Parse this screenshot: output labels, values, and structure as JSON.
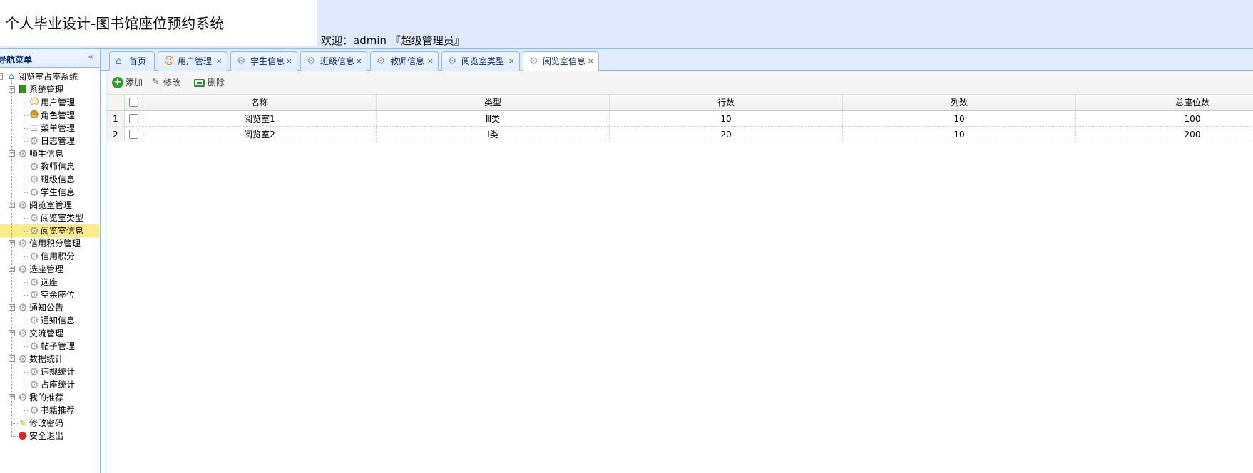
{
  "header": {
    "app_title": "个人毕业设计-图书馆座位预约系统",
    "welcome_prefix": "欢迎：",
    "username": "admin",
    "role": "『超级管理员』"
  },
  "sidebar": {
    "title": "导航菜单",
    "collapse_icon": "double-chevron-left-icon",
    "tree": {
      "root": "阅览室占座系统",
      "groups": [
        {
          "label": "系统管理",
          "items": [
            "用户管理",
            "角色管理",
            "菜单管理",
            "日志管理"
          ]
        },
        {
          "label": "师生信息",
          "items": [
            "教师信息",
            "班级信息",
            "学生信息"
          ]
        },
        {
          "label": "阅览室管理",
          "items": [
            "阅览室类型",
            "阅览室信息"
          ]
        },
        {
          "label": "信用积分管理",
          "items": [
            "信用积分"
          ]
        },
        {
          "label": "选座管理",
          "items": [
            "选座",
            "空余座位"
          ]
        },
        {
          "label": "通知公告",
          "items": [
            "通知信息"
          ]
        },
        {
          "label": "交流管理",
          "items": [
            "帖子管理"
          ]
        },
        {
          "label": "数据统计",
          "items": [
            "违规统计",
            "占座统计"
          ]
        },
        {
          "label": "我的推荐",
          "items": [
            "书籍推荐"
          ]
        }
      ],
      "leaves": [
        "修改密码",
        "安全退出"
      ],
      "selected": "阅览室信息"
    }
  },
  "tabs": [
    {
      "label": "首页",
      "icon": "home-icon",
      "closable": false
    },
    {
      "label": "用户管理",
      "icon": "user-icon",
      "closable": true
    },
    {
      "label": "学生信息",
      "icon": "gear-icon",
      "closable": true
    },
    {
      "label": "班级信息",
      "icon": "gear-icon",
      "closable": true
    },
    {
      "label": "教师信息",
      "icon": "gear-icon",
      "closable": true
    },
    {
      "label": "阅览室类型",
      "icon": "gear-icon",
      "closable": true
    },
    {
      "label": "阅览室信息",
      "icon": "gear-icon",
      "closable": true,
      "active": true
    }
  ],
  "toolbar": {
    "add_label": "添加",
    "edit_label": "修改",
    "delete_label": "删除"
  },
  "grid": {
    "columns": [
      "名称",
      "类型",
      "行数",
      "列数",
      "总座位数"
    ],
    "rows": [
      {
        "num": "1",
        "name": "阅览室1",
        "type": "Ⅲ类",
        "rows": "10",
        "cols": "10",
        "total": "100"
      },
      {
        "num": "2",
        "name": "阅览室2",
        "type": "Ⅰ类",
        "rows": "20",
        "cols": "10",
        "total": "200"
      }
    ]
  },
  "colors": {
    "header_bg": "#dfe9fb",
    "border": "#95b8e7",
    "selected_node": "#fbec88"
  }
}
